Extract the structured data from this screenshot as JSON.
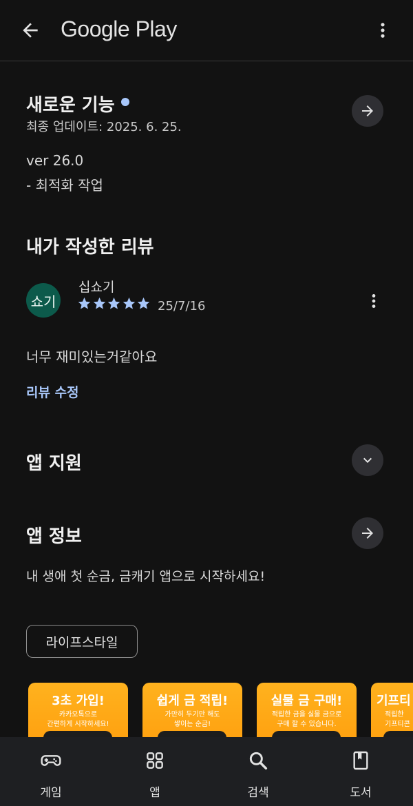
{
  "header": {
    "brand": "Google Play"
  },
  "whats_new": {
    "title": "새로운 기능",
    "updated": "최종 업데이트: 2025. 6. 25.",
    "version": "ver 26.0",
    "note": "- 최적화 작업"
  },
  "my_review": {
    "title": "내가 작성한 리뷰",
    "avatar_text": "쇼기",
    "reviewer": "십쇼기",
    "rating": 5,
    "date": "25/7/16",
    "text": "너무 재미있는거같아요",
    "edit_label": "리뷰 수정"
  },
  "app_support": {
    "title": "앱 지원"
  },
  "app_info": {
    "title": "앱 정보",
    "description": "내 생애 첫 순금, 금캐기 앱으로 시작하세요!",
    "category_chip": "라이프스타일"
  },
  "screenshots": [
    {
      "title": "3초 가입!",
      "line1": "카카오톡으로",
      "line2": "간편하게 시작하세요!"
    },
    {
      "title": "쉽게 금 적립!",
      "line1": "가만히 두기만 해도",
      "line2": "쌓이는 순금!"
    },
    {
      "title": "실물 금 구매!",
      "line1": "적립한 금을 실물 금으로",
      "line2": "구매 할 수 있습니다."
    },
    {
      "title": "기프티",
      "line1": "적립한",
      "line2": "기프티콘"
    }
  ],
  "bottom_nav": [
    {
      "label": "게임",
      "icon": "gamepad-icon"
    },
    {
      "label": "앱",
      "icon": "apps-grid-icon"
    },
    {
      "label": "검색",
      "icon": "search-icon"
    },
    {
      "label": "도서",
      "icon": "book-icon"
    }
  ],
  "colors": {
    "accent": "#a8c7fa",
    "star": "#a8c7fa",
    "avatar_bg": "#0c5a4b",
    "screenshot_bg": "#ffa514"
  }
}
